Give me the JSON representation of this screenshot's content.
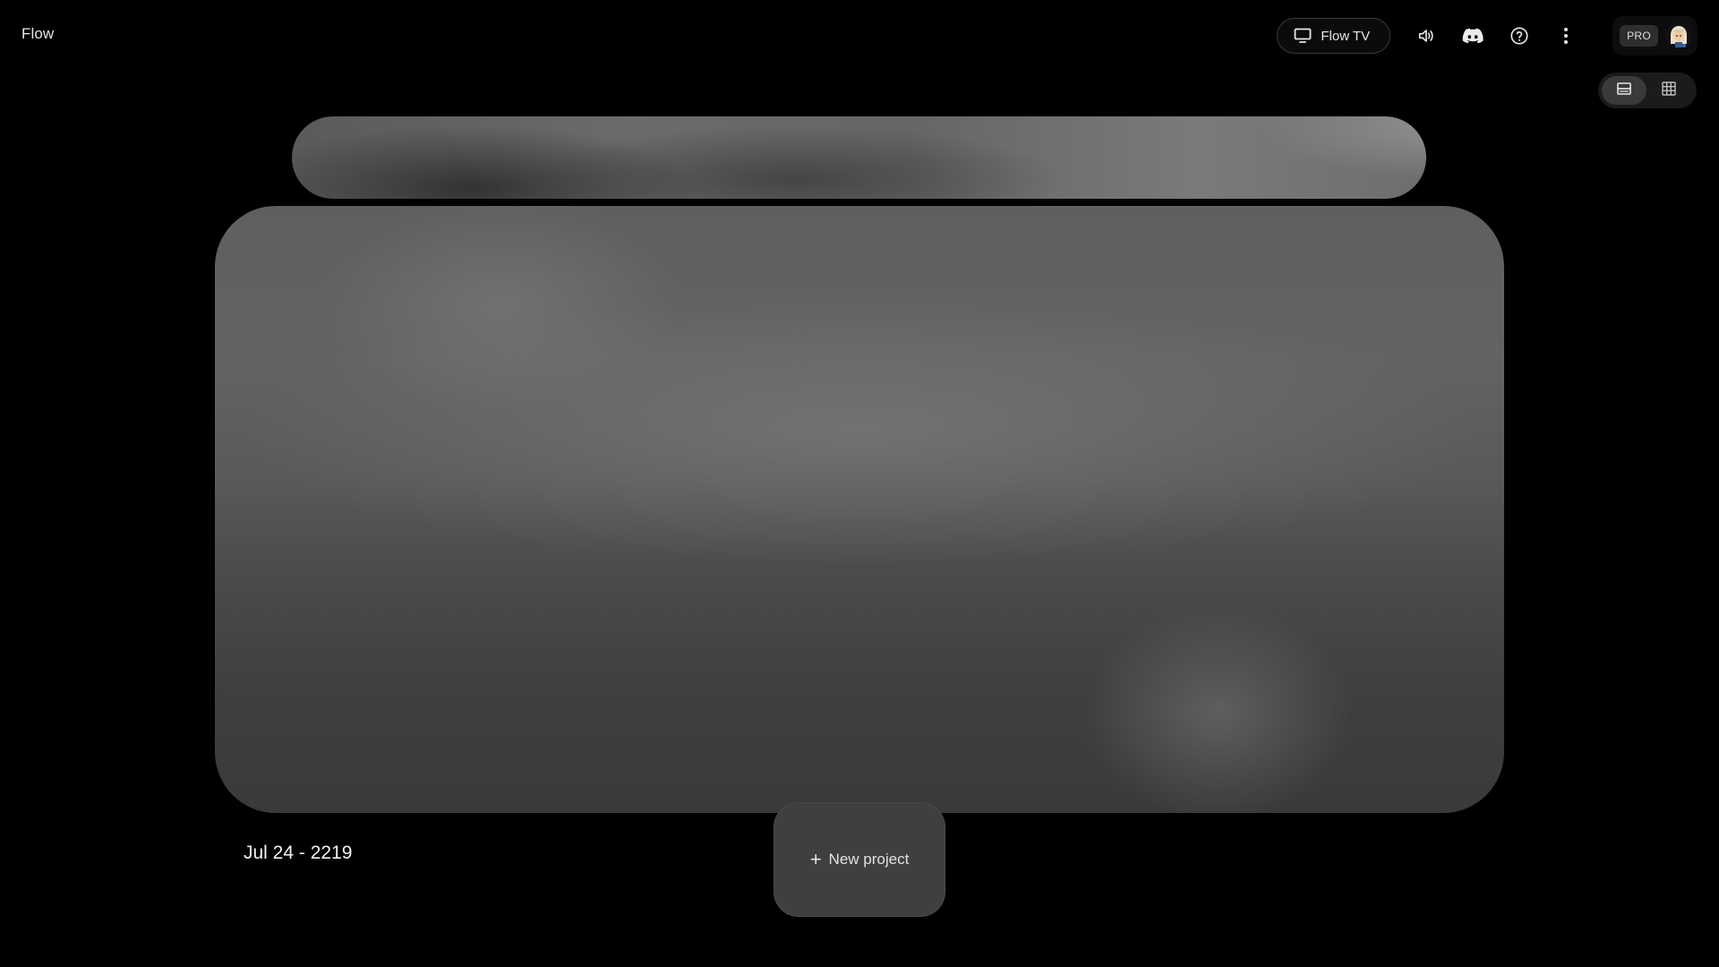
{
  "header": {
    "app_title": "Flow",
    "flow_tv_label": "Flow TV",
    "pro_badge": "PRO",
    "icons": {
      "flow_tv": "tv-icon",
      "sound": "volume-icon",
      "discord": "discord-icon",
      "help": "help-icon",
      "more": "more-vert-icon",
      "avatar": "avatar-icon"
    }
  },
  "view_toggle": {
    "selected": "list",
    "options": [
      "list-view-icon",
      "grid-view-icon"
    ]
  },
  "content": {
    "date_label": "Jul 24 - 2219",
    "new_project_label": "New project",
    "new_project_icon": "plus-icon"
  },
  "colors": {
    "background": "#000000",
    "text": "#e8e8e8",
    "button_bg": "#3f3f3f"
  }
}
